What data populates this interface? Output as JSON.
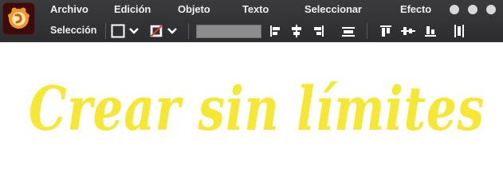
{
  "app": {
    "logo_icon": "app-logo-icon"
  },
  "menu": {
    "items": [
      {
        "id": "archivo",
        "label": "Archivo"
      },
      {
        "id": "edicion",
        "label": "Edición"
      },
      {
        "id": "objeto",
        "label": "Objeto"
      },
      {
        "id": "texto",
        "label": "Texto"
      },
      {
        "id": "seleccionar",
        "label": "Seleccionar"
      },
      {
        "id": "efecto",
        "label": "Efecto"
      }
    ]
  },
  "toolbar": {
    "selection_label": "Selección",
    "stroke_icon": "stroke-swatch-icon",
    "fill_icon": "fill-none-swatch-icon",
    "opacity_value": "",
    "align_icons": [
      "align-left-icon",
      "align-center-horizontal-icon",
      "align-right-icon",
      "distribute-horizontal-icon",
      "align-top-icon",
      "align-center-vertical-icon",
      "align-bottom-icon",
      "distribute-vertical-icon"
    ]
  },
  "canvas": {
    "text": "Crear sin límites",
    "text_color": "#f5e733"
  },
  "colors": {
    "bar_background": "#333335",
    "menu_text": "#eeeeee",
    "window_buttons": "#d8d8d8",
    "accent_orange": "#f39b1e"
  }
}
